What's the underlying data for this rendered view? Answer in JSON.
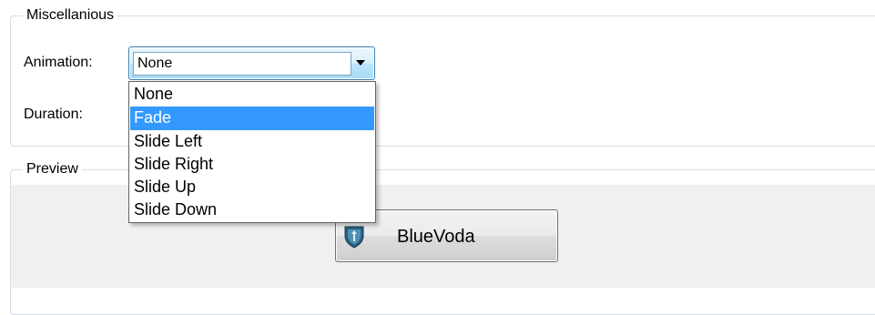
{
  "misc_group": {
    "title": "Miscellanious",
    "animation_label": "Animation:",
    "duration_label": "Duration:"
  },
  "animation_combo": {
    "selected": "None",
    "options": [
      "None",
      "Fade",
      "Slide Left",
      "Slide Right",
      "Slide Up",
      "Slide Down"
    ],
    "highlighted": "Fade"
  },
  "preview_group": {
    "title": "Preview",
    "button_label": "BlueVoda",
    "button_icon": "bluevoda-shield-icon"
  },
  "colors": {
    "highlight": "#3399ff",
    "group_border": "#d5dfe5",
    "preview_background": "#f0f0f0"
  }
}
